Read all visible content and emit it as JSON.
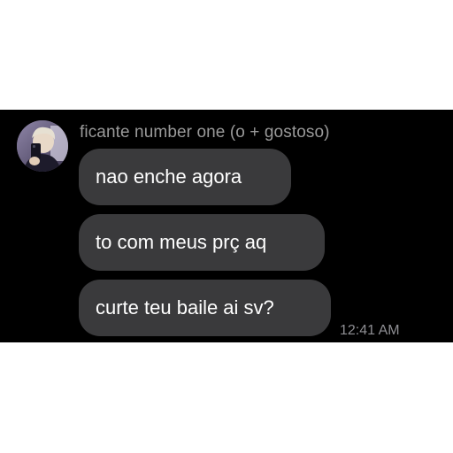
{
  "contact": {
    "name": "ficante number one (o + gostoso)",
    "avatar": "profile-photo"
  },
  "messages": [
    {
      "text": "nao enche agora"
    },
    {
      "text": "to com meus prç aq"
    },
    {
      "text": "curte teu baile ai sv?"
    }
  ],
  "timestamp": "12:41 AM",
  "colors": {
    "panel_background": "#000000",
    "bubble": "#3a3a3c",
    "message_text": "#ffffff",
    "meta_text": "#8e8e93"
  }
}
